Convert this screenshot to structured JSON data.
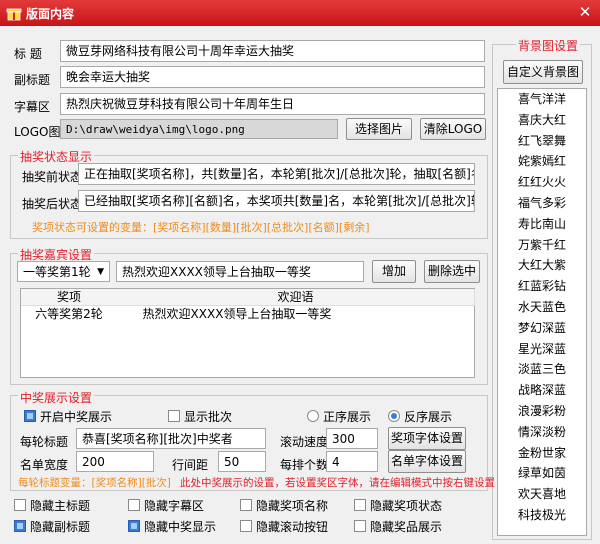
{
  "window": {
    "title": "版面内容",
    "close": "✕"
  },
  "title_label": "标   题",
  "title_value": "微豆芽网络科技有限公司十周年幸运大抽奖",
  "subtitle_label": "副标题",
  "subtitle_value": "晚会幸运大抽奖",
  "marquee_label": "字幕区",
  "marquee_value": "热烈庆祝微豆芽科技有限公司十年周年生日",
  "logo_label": "LOGO图片",
  "logo_path": "D:\\draw\\weidya\\img\\logo.png",
  "select_image": "选择图片",
  "clear_logo": "清除LOGO",
  "bg": {
    "group_title": "背景图设置",
    "custom_button": "自定义背景图",
    "themes": [
      "喜气洋洋",
      "喜庆大红",
      "红飞翠舞",
      "姹紫嫣红",
      "红红火火",
      "福气多彩",
      "寿比南山",
      "万紫千红",
      "大红大紫",
      "红蓝彩钻",
      "水天蓝色",
      "梦幻深蓝",
      "星光深蓝",
      "淡蓝三色",
      "战略深蓝",
      "浪漫彩粉",
      "情深淡粉",
      "金粉世家",
      "绿草如茵",
      "欢天喜地",
      "科技极光"
    ]
  },
  "status": {
    "group_title": "抽奖状态显示",
    "before_label": "抽奖前状态",
    "before_value": "正在抽取[奖项名称]，共[数量]名，本轮第[批次]/[总批次]轮，抽取[名额]名，剩余[剩",
    "after_label": "抽奖后状态",
    "after_value": "已经抽取[奖项名称][名额]名，本奖项共[数量]名，本轮第[批次]/[总批次]轮，剩余[剩",
    "vars_hint": "奖项状态可设置的变量：[奖项名称][数量][批次][总批次][名额][剩余]"
  },
  "guest": {
    "group_title": "抽奖嘉宾设置",
    "round_select": "一等奖第1轮",
    "greeting_value": "热烈欢迎XXXX领导上台抽取一等奖",
    "add_button": "增加",
    "delete_button": "删除选中",
    "table_headers": [
      "奖项",
      "欢迎语"
    ],
    "table_rows": [
      [
        "六等奖第2轮",
        "热烈欢迎XXXX领导上台抽取一等奖"
      ]
    ]
  },
  "display": {
    "group_title": "中奖展示设置",
    "enable_show": "开启中奖展示",
    "show_batch": "显示批次",
    "order_asc": "正序展示",
    "order_desc": "反序展示",
    "round_title_label": "每轮标题",
    "round_title_value": "恭喜[奖项名称][批次]中奖者",
    "scroll_speed_label": "滚动速度",
    "scroll_speed_value": "300",
    "prize_font_button": "奖项字体设置",
    "name_width_label": "名单宽度",
    "name_width_value": "200",
    "row_spacing_label": "行间距",
    "row_spacing_value": "50",
    "per_row_label": "每排个数",
    "per_row_value": "4",
    "name_font_button": "名单字体设置",
    "vars_prefix": "每轮标题变量：[奖项名称][批次]",
    "warning": "此处中奖展示的设置，若设置奖区字体，请在编辑模式中按右键设置"
  },
  "hide": {
    "main_title": "隐藏主标题",
    "marquee": "隐藏字幕区",
    "prize_name": "隐藏奖项名称",
    "prize_status": "隐藏奖项状态",
    "subtitle": "隐藏副标题",
    "winner_show": "隐藏中奖显示",
    "scroll_button": "隐藏滚动按钮",
    "prize_show": "隐藏奖品展示"
  },
  "colors": {
    "accent": "#e0202a",
    "titlebar": "#d0202a",
    "hint": "#f08c1e"
  }
}
